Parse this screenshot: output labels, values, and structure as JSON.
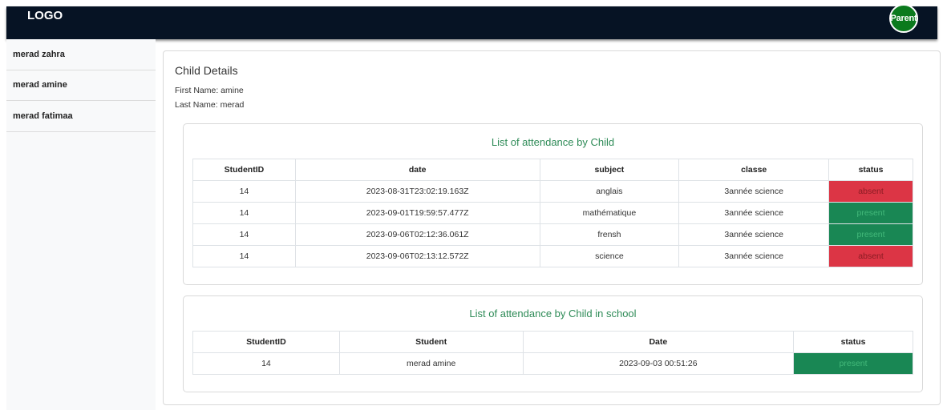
{
  "header": {
    "logo": "LOGO",
    "avatar_label": "Parent"
  },
  "sidebar": {
    "items": [
      {
        "label": "merad zahra"
      },
      {
        "label": "merad amine"
      },
      {
        "label": "merad fatimaa"
      }
    ]
  },
  "child": {
    "title": "Child Details",
    "first_name": "First Name: amine",
    "last_name": "Last Name: merad"
  },
  "attendance": {
    "title": "List of attendance by Child",
    "headers": [
      "StudentID",
      "date",
      "subject",
      "classe",
      "status"
    ],
    "rows": [
      {
        "id": "14",
        "date": "2023-08-31T23:02:19.163Z",
        "subject": "anglais",
        "classe": "3année science",
        "status": "absent"
      },
      {
        "id": "14",
        "date": "2023-09-01T19:59:57.477Z",
        "subject": "mathématique",
        "classe": "3année science",
        "status": "present"
      },
      {
        "id": "14",
        "date": "2023-09-06T02:12:36.061Z",
        "subject": "frensh",
        "classe": "3année science",
        "status": "present"
      },
      {
        "id": "14",
        "date": "2023-09-06T02:13:12.572Z",
        "subject": "science",
        "classe": "3année science",
        "status": "absent"
      }
    ]
  },
  "school_attendance": {
    "title": "List of attendance by Child in school",
    "headers": [
      "StudentID",
      "Student",
      "Date",
      "status"
    ],
    "rows": [
      {
        "id": "14",
        "student": "merad amine",
        "date": "2023-09-03 00:51:26",
        "status": "present"
      }
    ]
  },
  "colors": {
    "absent": "#dc3545",
    "present": "#198754",
    "accent_title": "#2e8b57",
    "topbar": "#061324"
  }
}
